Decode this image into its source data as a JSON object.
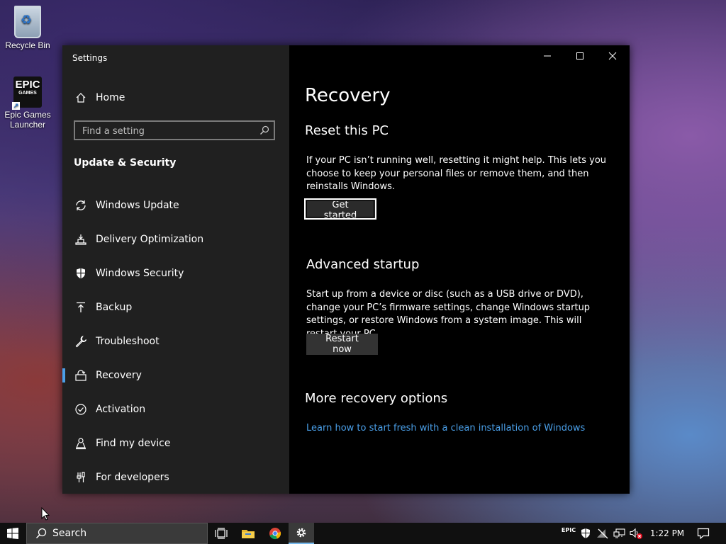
{
  "desktop": {
    "icons": [
      {
        "label": "Recycle Bin",
        "icon": "recycle-bin-icon"
      },
      {
        "label": "Epic Games Launcher",
        "icon": "epic-games-icon"
      }
    ]
  },
  "window": {
    "title": "Settings",
    "caption_buttons": [
      "minimize-icon",
      "maximize-icon",
      "close-icon"
    ]
  },
  "sidebar": {
    "home_label": "Home",
    "search_placeholder": "Find a setting",
    "section_label": "Update & Security",
    "items": [
      {
        "label": "Windows Update",
        "icon": "sync-icon"
      },
      {
        "label": "Delivery Optimization",
        "icon": "delivery-optimization-icon"
      },
      {
        "label": "Windows Security",
        "icon": "shield-icon"
      },
      {
        "label": "Backup",
        "icon": "backup-arrow-icon"
      },
      {
        "label": "Troubleshoot",
        "icon": "wrench-icon"
      },
      {
        "label": "Recovery",
        "icon": "recovery-icon",
        "selected": true
      },
      {
        "label": "Activation",
        "icon": "checkmark-circle-icon"
      },
      {
        "label": "Find my device",
        "icon": "person-location-icon"
      },
      {
        "label": "For developers",
        "icon": "developer-tools-icon"
      }
    ]
  },
  "main": {
    "title": "Recovery",
    "reset": {
      "heading": "Reset this PC",
      "description": "If your PC isn’t running well, resetting it might help. This lets you choose to keep your personal files or remove them, and then reinstalls Windows.",
      "button": "Get started"
    },
    "advanced": {
      "heading": "Advanced startup",
      "description": "Start up from a device or disc (such as a USB drive or DVD), change your PC’s firmware settings, change Windows startup settings, or restore Windows from a system image. This will restart your PC.",
      "button": "Restart now"
    },
    "more": {
      "heading": "More recovery options",
      "link": "Learn how to start fresh with a clean installation of Windows"
    }
  },
  "taskbar": {
    "search_label": "Search",
    "apps": [
      "task-view-icon",
      "file-explorer-icon",
      "chrome-icon",
      "settings-icon"
    ],
    "tray": [
      "epic-tray-icon",
      "security-tray-icon",
      "network-disabled-icon",
      "network-icon",
      "volume-muted-icon"
    ],
    "time": "1:22 PM"
  },
  "colors": {
    "accent": "#4a9fe8",
    "sidebar_bg": "#202020",
    "main_bg": "#000000"
  }
}
